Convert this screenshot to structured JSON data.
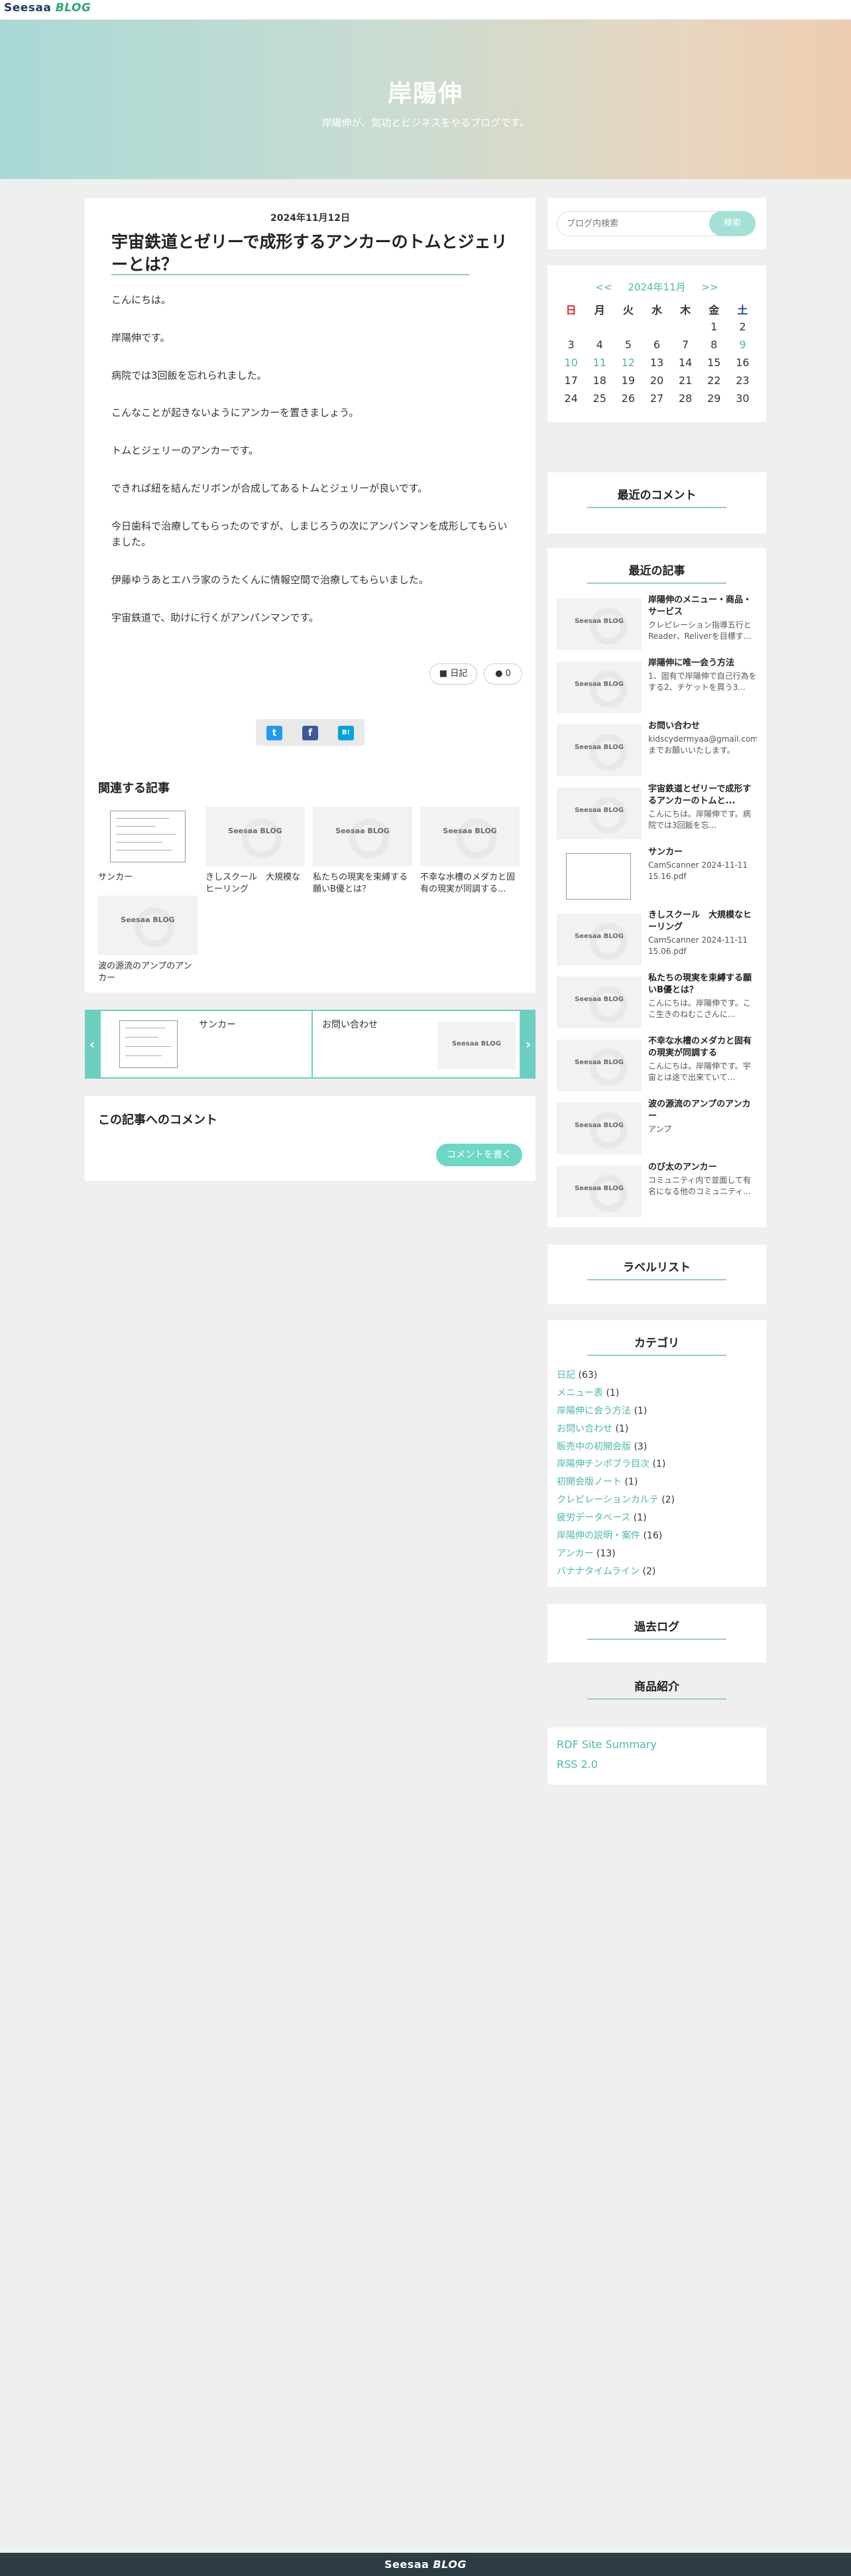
{
  "header": {
    "logo_a": "Seesaa",
    "logo_b": "BLOG"
  },
  "hero": {
    "title": "岸陽伸",
    "subtitle": "岸陽伸が、気功とビジネスをやるブログです。"
  },
  "article": {
    "date": "2024年11月12日",
    "title": "宇宙鉄道とゼリーで成形するアンカーのトムとジェリーとは？",
    "paragraphs": [
      "こんにちは。",
      "岸陽伸です。",
      "病院では3回飯を忘れられました。",
      "こんなことが起きないようにアンカーを置きましょう。",
      "トムとジェリーのアンカーです。",
      "できれば紐を結んだリボンが合成してあるトムとジェリーが良いです。",
      "今日歯科で治療してもらったのですが、しまじろうの次にアンパンマンを成形してもらいました。",
      "伊藤ゆうあとエハラ家のうたくんに情報空間で治療してもらいました。",
      "宇宙鉄道で、助けに行くがアンパンマンです。"
    ],
    "tag_label": "日記",
    "comment_count": "0"
  },
  "share": {
    "twitter": "t",
    "facebook": "f",
    "hatena": "B!"
  },
  "related": {
    "heading": "関連する記事",
    "placeholder": "Seesaa BLOG",
    "items": [
      {
        "caption": "サンカー"
      },
      {
        "caption": "きしスクール　大規模なヒーリング"
      },
      {
        "caption": "私たちの現実を束縛する願いB優とは？"
      },
      {
        "caption": "不幸な水槽のメダカと固有の現実が同調する..."
      },
      {
        "caption": "波の源流のアンプのアンカー"
      }
    ]
  },
  "pager": {
    "prev_title": "サンカー",
    "next_title": "お問い合わせ",
    "prev_arrow": "‹",
    "next_arrow": "›"
  },
  "comments": {
    "heading": "この記事へのコメント",
    "button": "コメントを書く"
  },
  "sidebar": {
    "search_placeholder": "ブログ内検索",
    "search_button": "検索",
    "calendar": {
      "prev": "<<",
      "month": "2024年11月",
      "next": ">>",
      "weekdays": [
        "日",
        "月",
        "火",
        "水",
        "木",
        "金",
        "土"
      ],
      "rows": [
        [
          "",
          "",
          "",
          "",
          "",
          "1",
          "2"
        ],
        [
          "3",
          "4",
          "5",
          "6",
          "7",
          "8",
          "9"
        ],
        [
          "10",
          "11",
          "12",
          "13",
          "14",
          "15",
          "16"
        ],
        [
          "17",
          "18",
          "19",
          "20",
          "21",
          "22",
          "23"
        ],
        [
          "24",
          "25",
          "26",
          "27",
          "28",
          "29",
          "30"
        ]
      ]
    },
    "recent_comments_title": "最近のコメント",
    "recent_articles_title": "最近の記事",
    "recent_articles": [
      {
        "title": "岸陽伸のメニュー・商品・サービス",
        "desc": "クレピレーション指導五行とReader、Reliverを目標す..."
      },
      {
        "title": "岸陽伸に唯一会う方法",
        "desc": "1、固有で岸陽伸で自己行為をする2、チケットを買う3..."
      },
      {
        "title": "お問い合わせ",
        "desc": "kidscydermyaa@gmail.comまでお願いいたします。"
      },
      {
        "title": "宇宙鉄道とゼリーで成形するアンカーのトムと...",
        "desc": "こんにちは。岸陽伸です。病院では3回飯を忘..."
      },
      {
        "title": "サンカー",
        "desc": "CamScanner 2024-11-11 15.16.pdf"
      },
      {
        "title": "きしスクール　大規模なヒーリング",
        "desc": "CamScanner 2024-11-11 15.06.pdf"
      },
      {
        "title": "私たちの現実を束縛する願いB優とは？",
        "desc": "こんにちは。岸陽伸です。ここ生きのねむこさんに..."
      },
      {
        "title": "不幸な水槽のメダカと固有の現実が同調する",
        "desc": "こんにちは。岸陽伸です。宇宙とは途で出来ていて..."
      },
      {
        "title": "波の源流のアンプのアンカー",
        "desc": "アンプ"
      },
      {
        "title": "のび太のアンカー",
        "desc": "コミュニティ内で並面して有名になる他のコミュニティ..."
      }
    ],
    "label_list_title": "ラベルリスト",
    "category_title": "カテゴリ",
    "categories": [
      {
        "name": "日記",
        "count": "(63)"
      },
      {
        "name": "メニュー表",
        "count": "(1)"
      },
      {
        "name": "岸陽伸に会う方法",
        "count": "(1)"
      },
      {
        "name": "お問い合わせ",
        "count": "(1)"
      },
      {
        "name": "販売中の初開会版",
        "count": "(3)"
      },
      {
        "name": "岸陽伸チンポブラ目次",
        "count": "(1)"
      },
      {
        "name": "初開会版ノート",
        "count": "(1)"
      },
      {
        "name": "クレピレーションカルテ",
        "count": "(2)"
      },
      {
        "name": "疲労データベース",
        "count": "(1)"
      },
      {
        "name": "岸陽伸の説明・案件",
        "count": "(16)"
      },
      {
        "name": "アンカー",
        "count": "(13)"
      },
      {
        "name": "バナナタイムライン",
        "count": "(2)"
      }
    ],
    "archive_title": "過去ログ",
    "product_title": "商品紹介",
    "rss": [
      "RDF Site Summary",
      "RSS 2.0"
    ]
  },
  "footer": {
    "logo_a": "Seesaa",
    "logo_b": "BLOG"
  },
  "colors": {
    "accent": "#6dcfc0",
    "link": "#4db8ab",
    "footer": "#2d3b45"
  }
}
